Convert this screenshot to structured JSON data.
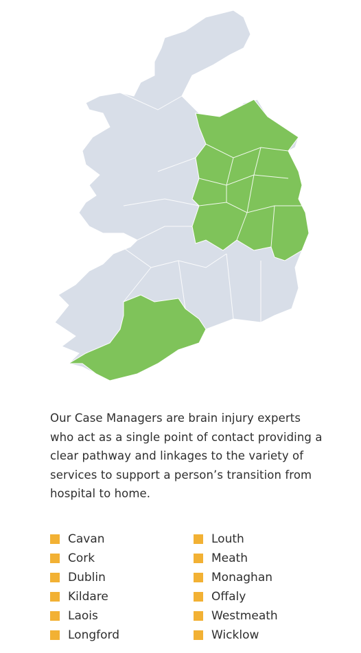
{
  "colors": {
    "land": "#d8dee8",
    "highlight": "#7fc35a",
    "border": "#ffffff",
    "bullet": "#f2b134"
  },
  "description": "Our Case Managers are brain injury experts who act as a single point of contact providing a clear pathway and linkages to the variety of services to support a person’s transition from hospital to home.",
  "counties_col1": [
    "Cavan",
    "Cork",
    "Dublin",
    "Kildare",
    "Laois",
    "Longford"
  ],
  "counties_col2": [
    "Louth",
    "Meath",
    "Monaghan",
    "Offaly",
    "Westmeath",
    "Wicklow"
  ]
}
